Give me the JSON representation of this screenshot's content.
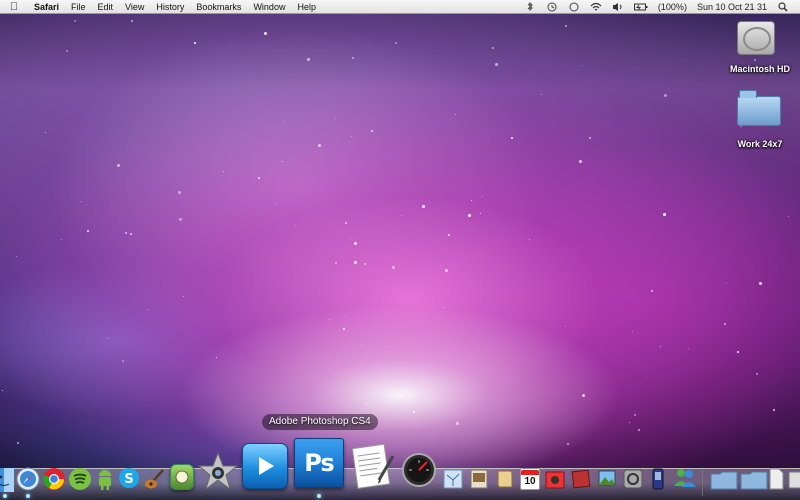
{
  "menubar": {
    "app_name": "Safari",
    "items": [
      "File",
      "Edit",
      "View",
      "History",
      "Bookmarks",
      "Window",
      "Help"
    ],
    "status": {
      "battery": "(100%)",
      "datetime": "Sun 10 Oct  21 31"
    }
  },
  "desktop": {
    "icons": [
      {
        "label": "Macintosh HD",
        "icon": "hard-drive-icon"
      },
      {
        "label": "Work 24x7",
        "icon": "folder-icon"
      }
    ]
  },
  "dock": {
    "tooltip": "Adobe Photoshop CS4",
    "photoshop_label": "Ps",
    "calendar_day": "10",
    "items": [
      "finder",
      "safari",
      "chrome",
      "spotify",
      "android",
      "skype",
      "garageband",
      "iphoto-screen",
      "imovie",
      "quicktime",
      "photoshop",
      "textedit",
      "dashboard",
      "mail",
      "preview",
      "scripts",
      "calendar",
      "photo-booth",
      "iphoto",
      "system-preferences",
      "phone",
      "messenger",
      "applications-folder",
      "documents-folder",
      "file-stack",
      "downloads-stack"
    ]
  },
  "colors": {
    "menubar_top": "#f7f7f7",
    "menubar_bottom": "#e2e2e2",
    "photoshop_blue": "#1f7fd6",
    "wallpaper_pink": "#ee78dc"
  }
}
